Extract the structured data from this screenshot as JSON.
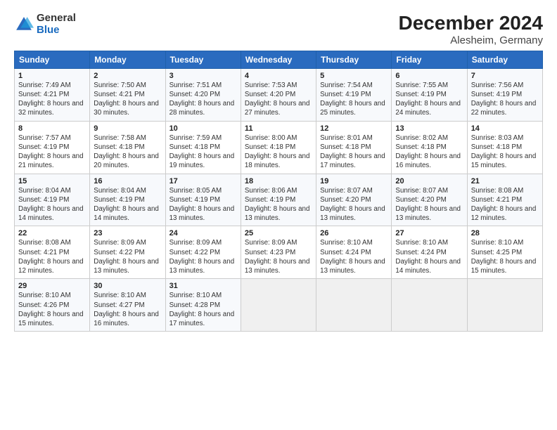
{
  "logo": {
    "general": "General",
    "blue": "Blue"
  },
  "title": "December 2024",
  "subtitle": "Alesheim, Germany",
  "days_header": [
    "Sunday",
    "Monday",
    "Tuesday",
    "Wednesday",
    "Thursday",
    "Friday",
    "Saturday"
  ],
  "weeks": [
    [
      {
        "day": "1",
        "sunrise": "Sunrise: 7:49 AM",
        "sunset": "Sunset: 4:21 PM",
        "daylight": "Daylight: 8 hours and 32 minutes."
      },
      {
        "day": "2",
        "sunrise": "Sunrise: 7:50 AM",
        "sunset": "Sunset: 4:21 PM",
        "daylight": "Daylight: 8 hours and 30 minutes."
      },
      {
        "day": "3",
        "sunrise": "Sunrise: 7:51 AM",
        "sunset": "Sunset: 4:20 PM",
        "daylight": "Daylight: 8 hours and 28 minutes."
      },
      {
        "day": "4",
        "sunrise": "Sunrise: 7:53 AM",
        "sunset": "Sunset: 4:20 PM",
        "daylight": "Daylight: 8 hours and 27 minutes."
      },
      {
        "day": "5",
        "sunrise": "Sunrise: 7:54 AM",
        "sunset": "Sunset: 4:19 PM",
        "daylight": "Daylight: 8 hours and 25 minutes."
      },
      {
        "day": "6",
        "sunrise": "Sunrise: 7:55 AM",
        "sunset": "Sunset: 4:19 PM",
        "daylight": "Daylight: 8 hours and 24 minutes."
      },
      {
        "day": "7",
        "sunrise": "Sunrise: 7:56 AM",
        "sunset": "Sunset: 4:19 PM",
        "daylight": "Daylight: 8 hours and 22 minutes."
      }
    ],
    [
      {
        "day": "8",
        "sunrise": "Sunrise: 7:57 AM",
        "sunset": "Sunset: 4:19 PM",
        "daylight": "Daylight: 8 hours and 21 minutes."
      },
      {
        "day": "9",
        "sunrise": "Sunrise: 7:58 AM",
        "sunset": "Sunset: 4:18 PM",
        "daylight": "Daylight: 8 hours and 20 minutes."
      },
      {
        "day": "10",
        "sunrise": "Sunrise: 7:59 AM",
        "sunset": "Sunset: 4:18 PM",
        "daylight": "Daylight: 8 hours and 19 minutes."
      },
      {
        "day": "11",
        "sunrise": "Sunrise: 8:00 AM",
        "sunset": "Sunset: 4:18 PM",
        "daylight": "Daylight: 8 hours and 18 minutes."
      },
      {
        "day": "12",
        "sunrise": "Sunrise: 8:01 AM",
        "sunset": "Sunset: 4:18 PM",
        "daylight": "Daylight: 8 hours and 17 minutes."
      },
      {
        "day": "13",
        "sunrise": "Sunrise: 8:02 AM",
        "sunset": "Sunset: 4:18 PM",
        "daylight": "Daylight: 8 hours and 16 minutes."
      },
      {
        "day": "14",
        "sunrise": "Sunrise: 8:03 AM",
        "sunset": "Sunset: 4:18 PM",
        "daylight": "Daylight: 8 hours and 15 minutes."
      }
    ],
    [
      {
        "day": "15",
        "sunrise": "Sunrise: 8:04 AM",
        "sunset": "Sunset: 4:19 PM",
        "daylight": "Daylight: 8 hours and 14 minutes."
      },
      {
        "day": "16",
        "sunrise": "Sunrise: 8:04 AM",
        "sunset": "Sunset: 4:19 PM",
        "daylight": "Daylight: 8 hours and 14 minutes."
      },
      {
        "day": "17",
        "sunrise": "Sunrise: 8:05 AM",
        "sunset": "Sunset: 4:19 PM",
        "daylight": "Daylight: 8 hours and 13 minutes."
      },
      {
        "day": "18",
        "sunrise": "Sunrise: 8:06 AM",
        "sunset": "Sunset: 4:19 PM",
        "daylight": "Daylight: 8 hours and 13 minutes."
      },
      {
        "day": "19",
        "sunrise": "Sunrise: 8:07 AM",
        "sunset": "Sunset: 4:20 PM",
        "daylight": "Daylight: 8 hours and 13 minutes."
      },
      {
        "day": "20",
        "sunrise": "Sunrise: 8:07 AM",
        "sunset": "Sunset: 4:20 PM",
        "daylight": "Daylight: 8 hours and 13 minutes."
      },
      {
        "day": "21",
        "sunrise": "Sunrise: 8:08 AM",
        "sunset": "Sunset: 4:21 PM",
        "daylight": "Daylight: 8 hours and 12 minutes."
      }
    ],
    [
      {
        "day": "22",
        "sunrise": "Sunrise: 8:08 AM",
        "sunset": "Sunset: 4:21 PM",
        "daylight": "Daylight: 8 hours and 12 minutes."
      },
      {
        "day": "23",
        "sunrise": "Sunrise: 8:09 AM",
        "sunset": "Sunset: 4:22 PM",
        "daylight": "Daylight: 8 hours and 13 minutes."
      },
      {
        "day": "24",
        "sunrise": "Sunrise: 8:09 AM",
        "sunset": "Sunset: 4:22 PM",
        "daylight": "Daylight: 8 hours and 13 minutes."
      },
      {
        "day": "25",
        "sunrise": "Sunrise: 8:09 AM",
        "sunset": "Sunset: 4:23 PM",
        "daylight": "Daylight: 8 hours and 13 minutes."
      },
      {
        "day": "26",
        "sunrise": "Sunrise: 8:10 AM",
        "sunset": "Sunset: 4:24 PM",
        "daylight": "Daylight: 8 hours and 13 minutes."
      },
      {
        "day": "27",
        "sunrise": "Sunrise: 8:10 AM",
        "sunset": "Sunset: 4:24 PM",
        "daylight": "Daylight: 8 hours and 14 minutes."
      },
      {
        "day": "28",
        "sunrise": "Sunrise: 8:10 AM",
        "sunset": "Sunset: 4:25 PM",
        "daylight": "Daylight: 8 hours and 15 minutes."
      }
    ],
    [
      {
        "day": "29",
        "sunrise": "Sunrise: 8:10 AM",
        "sunset": "Sunset: 4:26 PM",
        "daylight": "Daylight: 8 hours and 15 minutes."
      },
      {
        "day": "30",
        "sunrise": "Sunrise: 8:10 AM",
        "sunset": "Sunset: 4:27 PM",
        "daylight": "Daylight: 8 hours and 16 minutes."
      },
      {
        "day": "31",
        "sunrise": "Sunrise: 8:10 AM",
        "sunset": "Sunset: 4:28 PM",
        "daylight": "Daylight: 8 hours and 17 minutes."
      },
      null,
      null,
      null,
      null
    ]
  ]
}
